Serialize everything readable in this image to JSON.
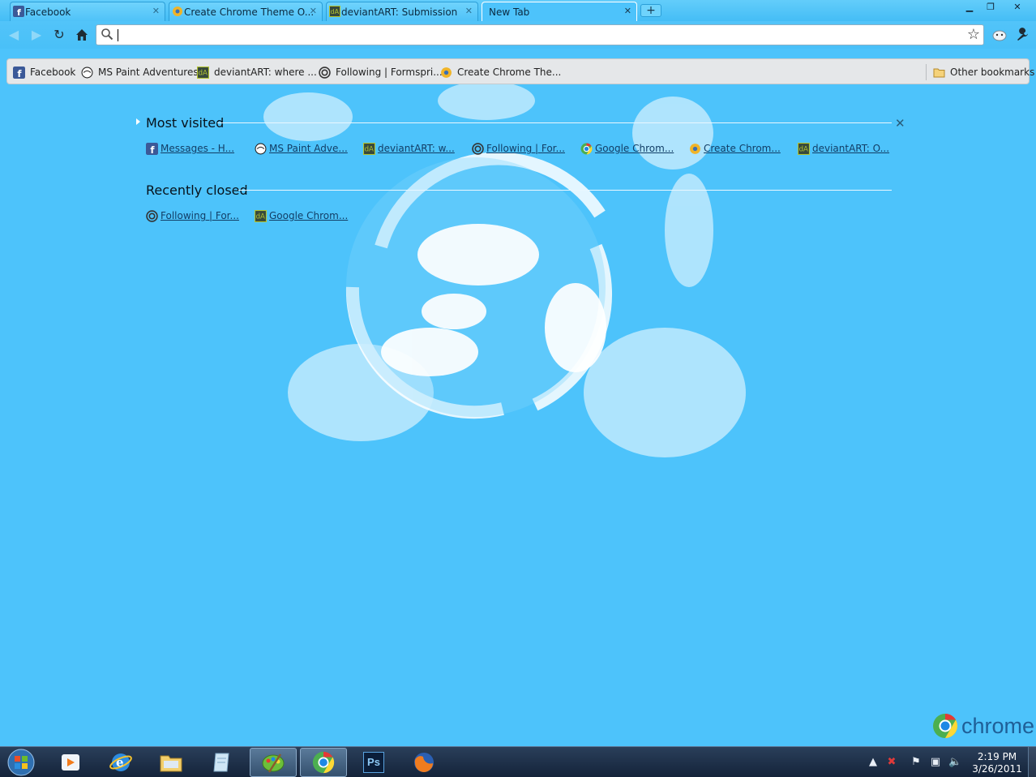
{
  "tabs": [
    {
      "title": "Facebook",
      "icon": "facebook-icon"
    },
    {
      "title": "Create Chrome Theme O...",
      "icon": "chrome-theme-creator-icon"
    },
    {
      "title": "deviantART: Submission",
      "icon": "deviantart-icon"
    },
    {
      "title": "New Tab",
      "icon": "",
      "active": true
    }
  ],
  "toolbar": {
    "omnibox_value": "",
    "back": "back-arrow-icon",
    "forward": "forward-arrow-icon",
    "reload": "reload-icon",
    "home": "home-icon",
    "star": "star-icon",
    "page_menu": "page-icon",
    "wrench": "wrench-icon"
  },
  "bookmarks": [
    {
      "label": "Facebook",
      "icon": "facebook-icon"
    },
    {
      "label": "MS Paint Adventures",
      "icon": "ms-paint-adventures-icon"
    },
    {
      "label": "deviantART: where ...",
      "icon": "deviantart-icon"
    },
    {
      "label": "Following | Formspri...",
      "icon": "formspring-icon"
    },
    {
      "label": "Create Chrome The...",
      "icon": "chrome-theme-creator-icon"
    }
  ],
  "other_bookmarks": "Other bookmarks",
  "most_visited": {
    "title": "Most visited",
    "items": [
      {
        "label": "Messages - H...",
        "icon": "facebook-icon"
      },
      {
        "label": "MS Paint Adve...",
        "icon": "ms-paint-adventures-icon"
      },
      {
        "label": "deviantART: w...",
        "icon": "deviantart-icon"
      },
      {
        "label": "Following | For...",
        "icon": "formspring-icon"
      },
      {
        "label": "Google Chrom...",
        "icon": "chrome-icon"
      },
      {
        "label": "Create Chrom...",
        "icon": "chrome-theme-creator-icon"
      },
      {
        "label": "deviantART: O...",
        "icon": "deviantart-icon"
      }
    ]
  },
  "recently_closed": {
    "title": "Recently closed",
    "items": [
      {
        "label": "Following | For...",
        "icon": "formspring-icon"
      },
      {
        "label": "Google Chrom...",
        "icon": "deviantart-icon"
      }
    ]
  },
  "brand": "chrome",
  "taskbar": {
    "apps": [
      "windows-start-icon",
      "media-player-icon",
      "internet-explorer-icon",
      "file-explorer-icon",
      "notepad-icon",
      "paint-app-icon",
      "chrome-icon",
      "photoshop-icon",
      "firefox-icon"
    ],
    "photoshop_label": "Ps",
    "clock_time": "2:19 PM",
    "clock_date": "3/26/2011"
  },
  "colors": {
    "theme_background": "#4dc3fb",
    "bookmarks_bar": "#e5e7e9",
    "link": "#123e66",
    "taskbar": "#1c2c44"
  }
}
